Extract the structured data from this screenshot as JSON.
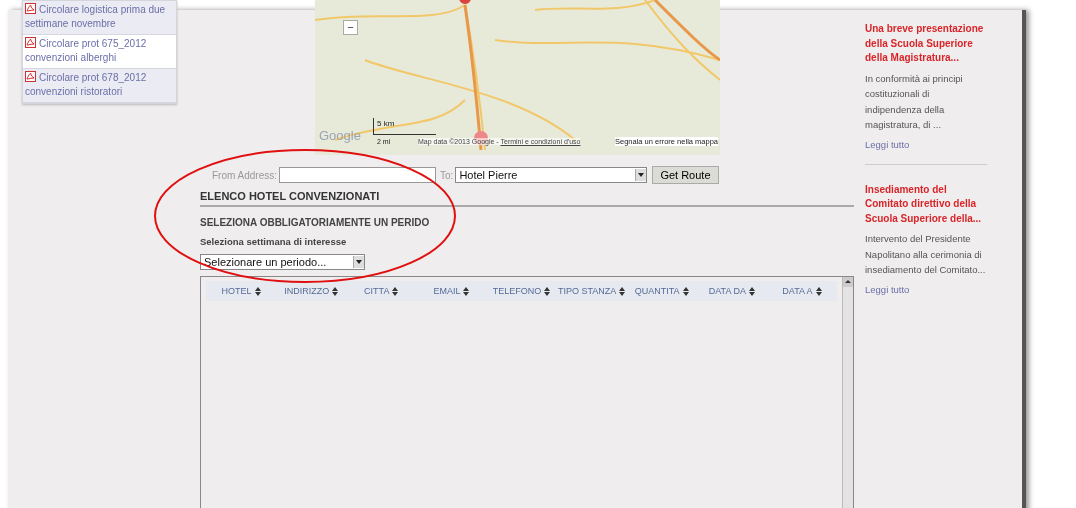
{
  "sidebar_links": [
    {
      "text": "Circolare logistica prima due settimane novembre",
      "selected": false
    },
    {
      "text": "Circolare prot 675_2012 convenzioni alberghi",
      "selected": true
    },
    {
      "text": "Circolare prot 678_2012 convenzioni ristoratori",
      "selected": false
    }
  ],
  "map": {
    "zoom_out": "−",
    "logo": "Google",
    "scale_km": "5 km",
    "scale_mi": "2 mi",
    "attribution": "Map data ©2013 Google -",
    "terms": "Termini e condizioni d'uso",
    "report": "Segnala un errore nella mappa"
  },
  "route": {
    "from_label": "From Address:",
    "to_label": "To:",
    "to_value": "Hotel Pierre",
    "button": "Get Route"
  },
  "section": {
    "title": "ELENCO HOTEL CONVENZIONATI",
    "subtitle": "SELEZIONA OBBLIGATORIAMENTE UN PERIDO",
    "label": "Seleziona settimana di interesse",
    "select_value": "Selezionare un periodo..."
  },
  "table": {
    "columns": [
      "HOTEL",
      "INDIRIZZO",
      "CITTA",
      "EMAIL",
      "TELEFONO",
      "TIPO STANZA",
      "QUANTITA",
      "DATA DA",
      "DATA A"
    ]
  },
  "news": [
    {
      "title": "Una breve presentazione della Scuola Superiore della Magistratura...",
      "body": "In conformità ai principi costituzionali di indipendenza della magistratura, di ...",
      "link": "Leggi tutto"
    },
    {
      "title": "Insediamento del Comitato direttivo della Scuola Superiore della...",
      "body": "Intervento del Presidente Napolitano alla cerimonia di insediamento del Comitato...",
      "link": "Leggi tutto"
    }
  ]
}
